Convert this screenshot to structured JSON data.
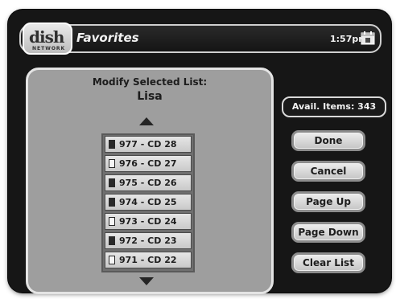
{
  "header": {
    "logo_text": "dish",
    "logo_subtext": "NETWORK",
    "title": "Favorites",
    "time": "1:57pm"
  },
  "panel": {
    "heading": "Modify Selected List:",
    "list_name": "Lisa",
    "items": [
      {
        "label": "977 - CD 28",
        "icon": "filled-document-icon"
      },
      {
        "label": "976 - CD 27",
        "icon": "empty-document-icon"
      },
      {
        "label": "975 - CD 26",
        "icon": "filled-document-icon"
      },
      {
        "label": "974 - CD 25",
        "icon": "filled-document-icon"
      },
      {
        "label": "973 - CD 24",
        "icon": "empty-document-icon"
      },
      {
        "label": "972 - CD 23",
        "icon": "filled-document-icon"
      },
      {
        "label": "971 - CD 22",
        "icon": "empty-document-icon"
      }
    ]
  },
  "sidebar": {
    "avail_label": "Avail. Items: 343",
    "buttons": {
      "done": "Done",
      "cancel": "Cancel",
      "page_up": "Page Up",
      "page_down": "Page Down",
      "clear_list": "Clear List"
    }
  },
  "colors": {
    "background": "#161616",
    "panel": "#9e9e9e",
    "button": "#dcdcdc"
  }
}
